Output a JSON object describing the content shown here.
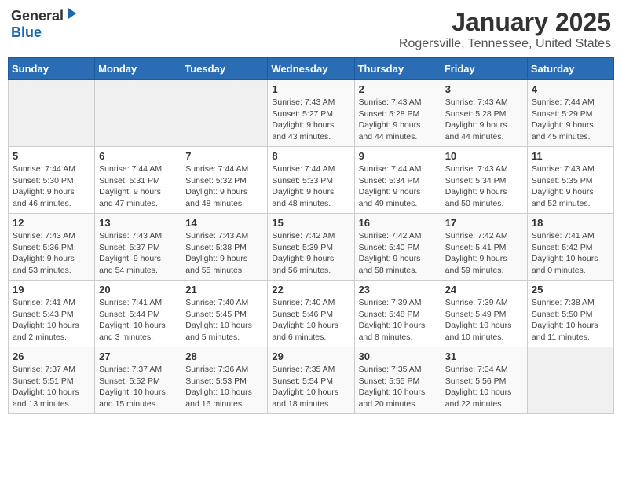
{
  "header": {
    "logo_general": "General",
    "logo_blue": "Blue",
    "title": "January 2025",
    "subtitle": "Rogersville, Tennessee, United States"
  },
  "weekdays": [
    "Sunday",
    "Monday",
    "Tuesday",
    "Wednesday",
    "Thursday",
    "Friday",
    "Saturday"
  ],
  "weeks": [
    [
      {
        "day": "",
        "info": ""
      },
      {
        "day": "",
        "info": ""
      },
      {
        "day": "",
        "info": ""
      },
      {
        "day": "1",
        "info": "Sunrise: 7:43 AM\nSunset: 5:27 PM\nDaylight: 9 hours\nand 43 minutes."
      },
      {
        "day": "2",
        "info": "Sunrise: 7:43 AM\nSunset: 5:28 PM\nDaylight: 9 hours\nand 44 minutes."
      },
      {
        "day": "3",
        "info": "Sunrise: 7:43 AM\nSunset: 5:28 PM\nDaylight: 9 hours\nand 44 minutes."
      },
      {
        "day": "4",
        "info": "Sunrise: 7:44 AM\nSunset: 5:29 PM\nDaylight: 9 hours\nand 45 minutes."
      }
    ],
    [
      {
        "day": "5",
        "info": "Sunrise: 7:44 AM\nSunset: 5:30 PM\nDaylight: 9 hours\nand 46 minutes."
      },
      {
        "day": "6",
        "info": "Sunrise: 7:44 AM\nSunset: 5:31 PM\nDaylight: 9 hours\nand 47 minutes."
      },
      {
        "day": "7",
        "info": "Sunrise: 7:44 AM\nSunset: 5:32 PM\nDaylight: 9 hours\nand 48 minutes."
      },
      {
        "day": "8",
        "info": "Sunrise: 7:44 AM\nSunset: 5:33 PM\nDaylight: 9 hours\nand 48 minutes."
      },
      {
        "day": "9",
        "info": "Sunrise: 7:44 AM\nSunset: 5:34 PM\nDaylight: 9 hours\nand 49 minutes."
      },
      {
        "day": "10",
        "info": "Sunrise: 7:43 AM\nSunset: 5:34 PM\nDaylight: 9 hours\nand 50 minutes."
      },
      {
        "day": "11",
        "info": "Sunrise: 7:43 AM\nSunset: 5:35 PM\nDaylight: 9 hours\nand 52 minutes."
      }
    ],
    [
      {
        "day": "12",
        "info": "Sunrise: 7:43 AM\nSunset: 5:36 PM\nDaylight: 9 hours\nand 53 minutes."
      },
      {
        "day": "13",
        "info": "Sunrise: 7:43 AM\nSunset: 5:37 PM\nDaylight: 9 hours\nand 54 minutes."
      },
      {
        "day": "14",
        "info": "Sunrise: 7:43 AM\nSunset: 5:38 PM\nDaylight: 9 hours\nand 55 minutes."
      },
      {
        "day": "15",
        "info": "Sunrise: 7:42 AM\nSunset: 5:39 PM\nDaylight: 9 hours\nand 56 minutes."
      },
      {
        "day": "16",
        "info": "Sunrise: 7:42 AM\nSunset: 5:40 PM\nDaylight: 9 hours\nand 58 minutes."
      },
      {
        "day": "17",
        "info": "Sunrise: 7:42 AM\nSunset: 5:41 PM\nDaylight: 9 hours\nand 59 minutes."
      },
      {
        "day": "18",
        "info": "Sunrise: 7:41 AM\nSunset: 5:42 PM\nDaylight: 10 hours\nand 0 minutes."
      }
    ],
    [
      {
        "day": "19",
        "info": "Sunrise: 7:41 AM\nSunset: 5:43 PM\nDaylight: 10 hours\nand 2 minutes."
      },
      {
        "day": "20",
        "info": "Sunrise: 7:41 AM\nSunset: 5:44 PM\nDaylight: 10 hours\nand 3 minutes."
      },
      {
        "day": "21",
        "info": "Sunrise: 7:40 AM\nSunset: 5:45 PM\nDaylight: 10 hours\nand 5 minutes."
      },
      {
        "day": "22",
        "info": "Sunrise: 7:40 AM\nSunset: 5:46 PM\nDaylight: 10 hours\nand 6 minutes."
      },
      {
        "day": "23",
        "info": "Sunrise: 7:39 AM\nSunset: 5:48 PM\nDaylight: 10 hours\nand 8 minutes."
      },
      {
        "day": "24",
        "info": "Sunrise: 7:39 AM\nSunset: 5:49 PM\nDaylight: 10 hours\nand 10 minutes."
      },
      {
        "day": "25",
        "info": "Sunrise: 7:38 AM\nSunset: 5:50 PM\nDaylight: 10 hours\nand 11 minutes."
      }
    ],
    [
      {
        "day": "26",
        "info": "Sunrise: 7:37 AM\nSunset: 5:51 PM\nDaylight: 10 hours\nand 13 minutes."
      },
      {
        "day": "27",
        "info": "Sunrise: 7:37 AM\nSunset: 5:52 PM\nDaylight: 10 hours\nand 15 minutes."
      },
      {
        "day": "28",
        "info": "Sunrise: 7:36 AM\nSunset: 5:53 PM\nDaylight: 10 hours\nand 16 minutes."
      },
      {
        "day": "29",
        "info": "Sunrise: 7:35 AM\nSunset: 5:54 PM\nDaylight: 10 hours\nand 18 minutes."
      },
      {
        "day": "30",
        "info": "Sunrise: 7:35 AM\nSunset: 5:55 PM\nDaylight: 10 hours\nand 20 minutes."
      },
      {
        "day": "31",
        "info": "Sunrise: 7:34 AM\nSunset: 5:56 PM\nDaylight: 10 hours\nand 22 minutes."
      },
      {
        "day": "",
        "info": ""
      }
    ]
  ]
}
